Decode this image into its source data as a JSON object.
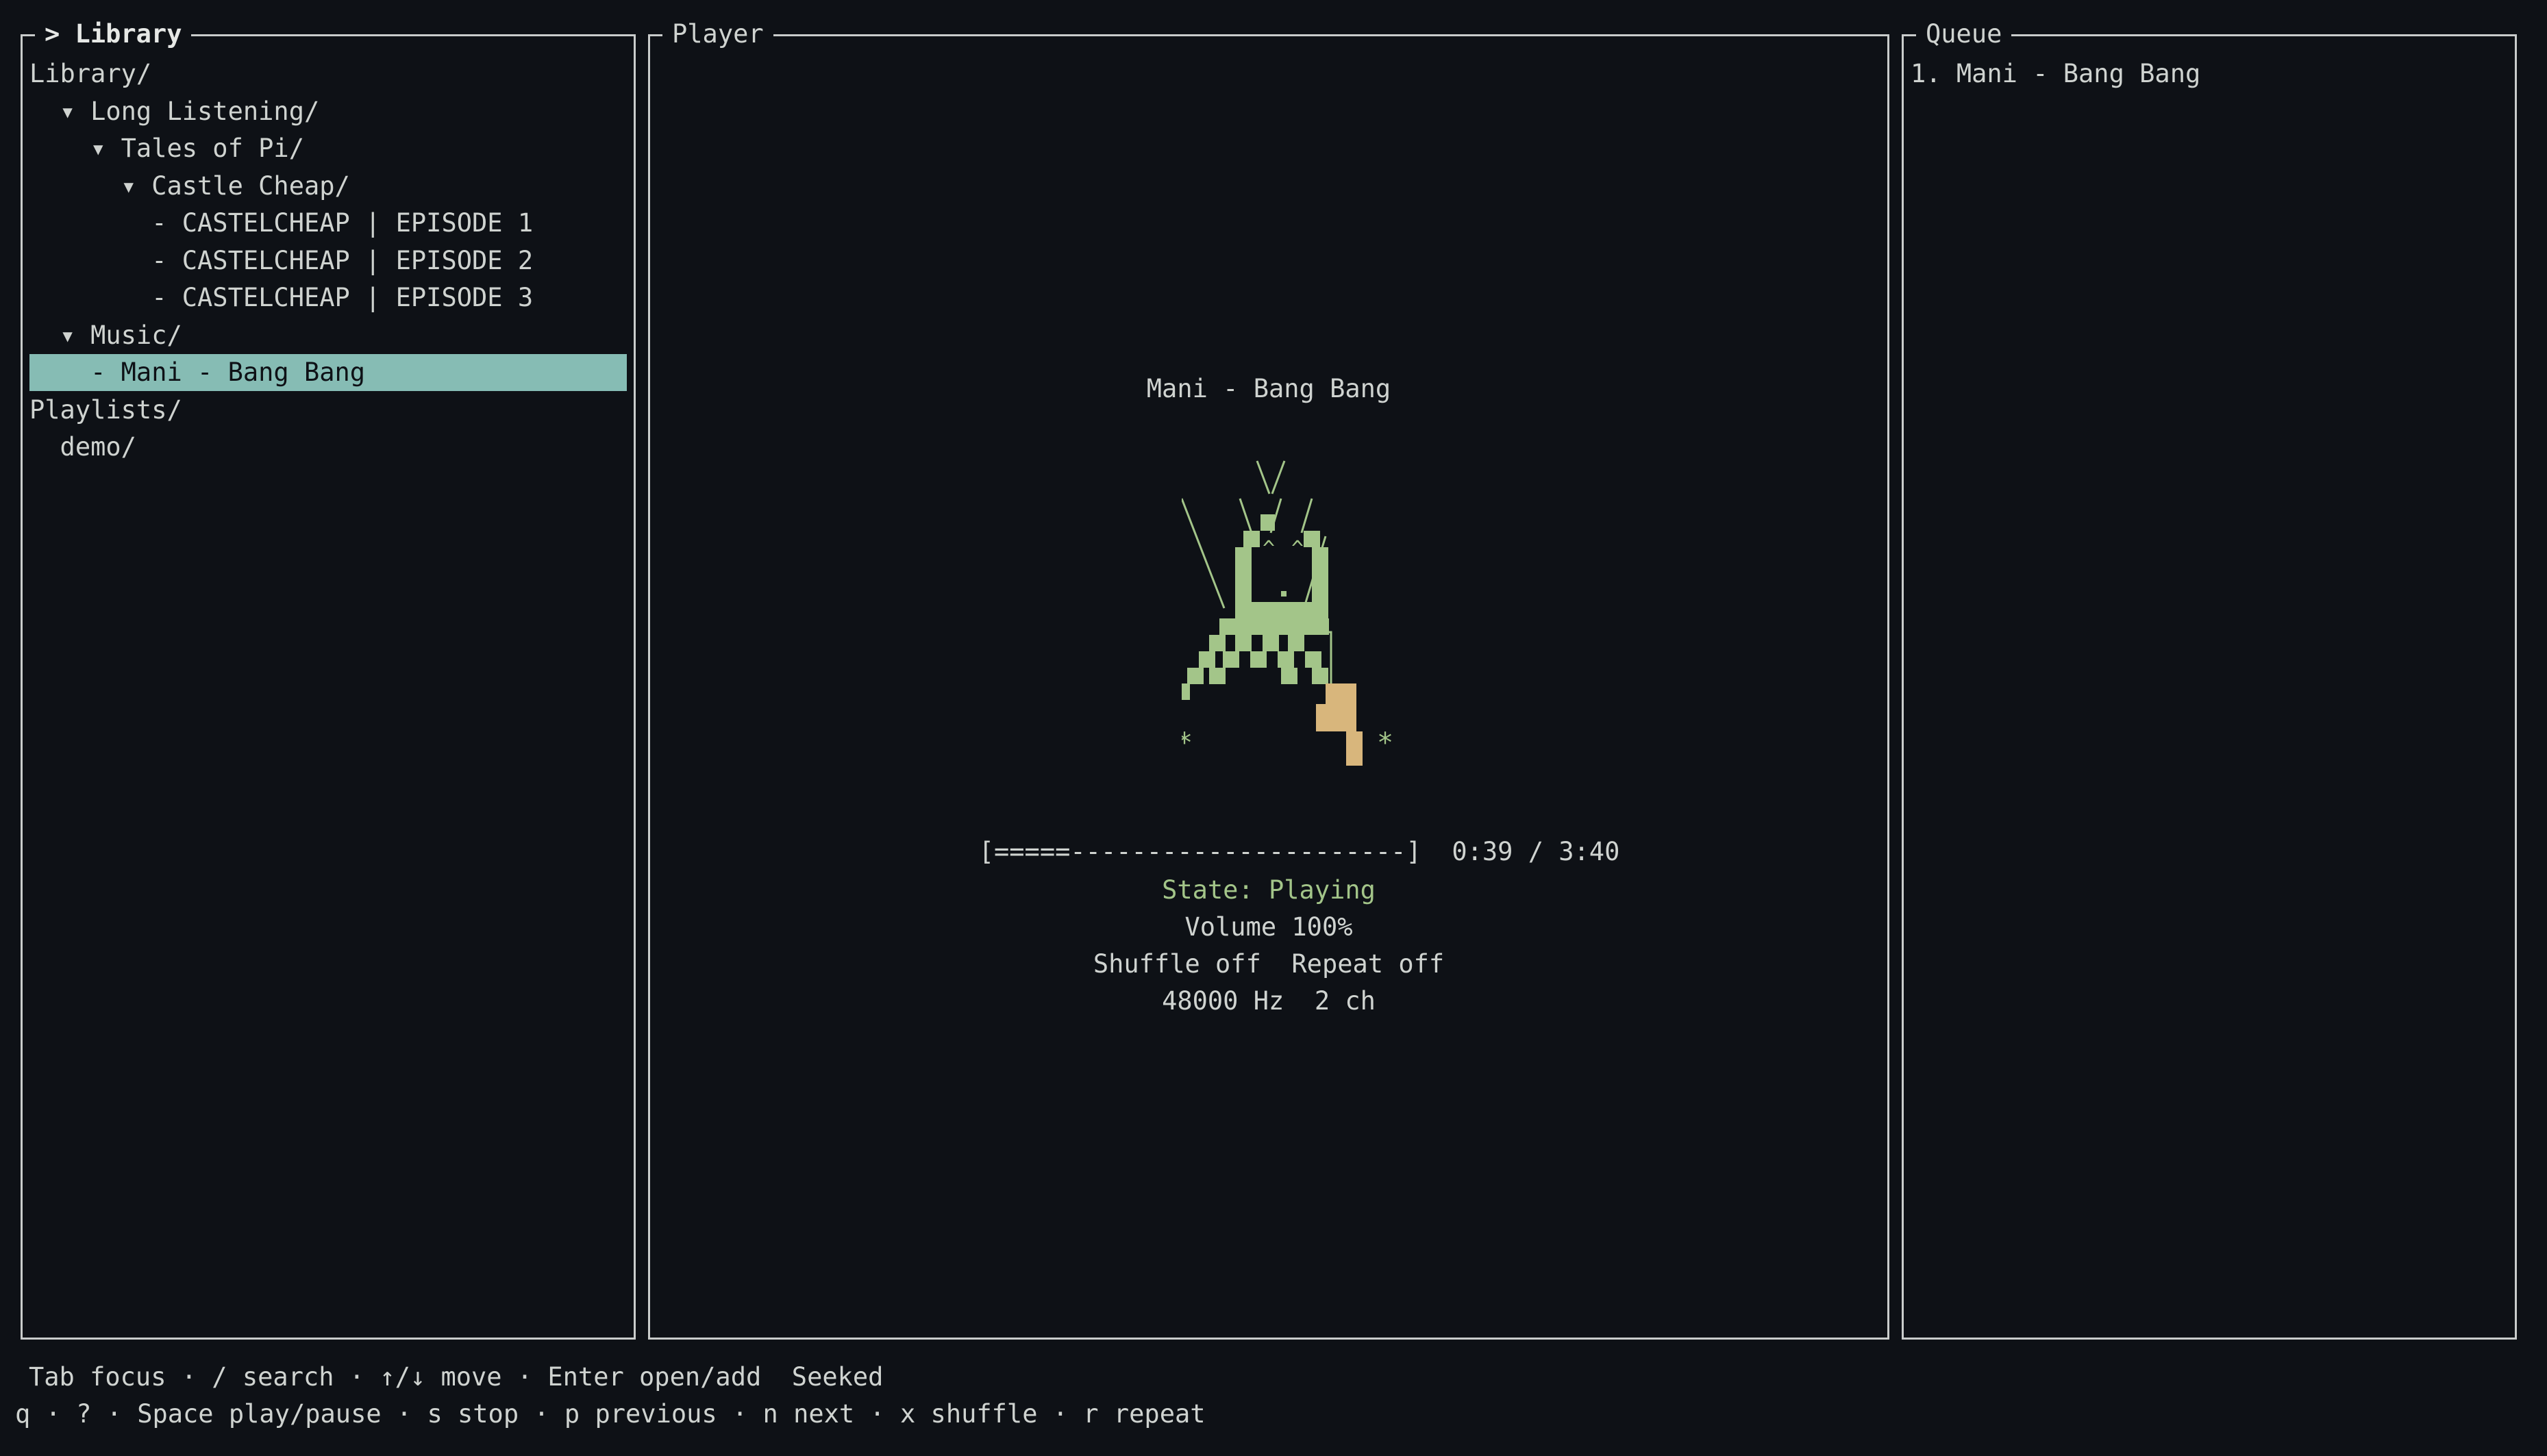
{
  "library": {
    "title": "> Library",
    "items": [
      {
        "label": "Library/"
      },
      {
        "label": "  ▾ Long Listening/"
      },
      {
        "label": "    ▾ Tales of Pi/"
      },
      {
        "label": "      ▾ Castle Cheap/"
      },
      {
        "label": "        - CASTELCHEAP | EPISODE 1"
      },
      {
        "label": "        - CASTELCHEAP | EPISODE 2"
      },
      {
        "label": "        - CASTELCHEAP | EPISODE 3"
      },
      {
        "label": "  ▾ Music/"
      },
      {
        "label": "    - Mani - Bang Bang",
        "selected": true
      },
      {
        "label": "Playlists/"
      },
      {
        "label": "  demo/"
      }
    ]
  },
  "player": {
    "title": "Player",
    "track": "Mani - Bang Bang",
    "art_markers": [
      "*",
      "*"
    ],
    "progress_bar": "[=====----------------------]",
    "progress_fraction": 0.177,
    "time": "0:39 / 3:40",
    "state": "State: Playing",
    "volume": "Volume 100%",
    "shuffle_repeat": "Shuffle off  Repeat off",
    "audio": "48000 Hz  2 ch"
  },
  "queue": {
    "title": "Queue",
    "items": [
      "1. Mani - Bang Bang"
    ]
  },
  "footer": {
    "line1": "Tab focus · / search · ↑/↓ move · Enter open/add  Seeked",
    "line2": "q · ? · Space play/pause · s stop · p previous · n next · x shuffle · r repeat"
  },
  "colors": {
    "background": "#0e1116",
    "selection": "#86bcb4",
    "state_green": "#a3c589",
    "art_green": "#a3c589",
    "art_tan": "#d8b67c"
  }
}
